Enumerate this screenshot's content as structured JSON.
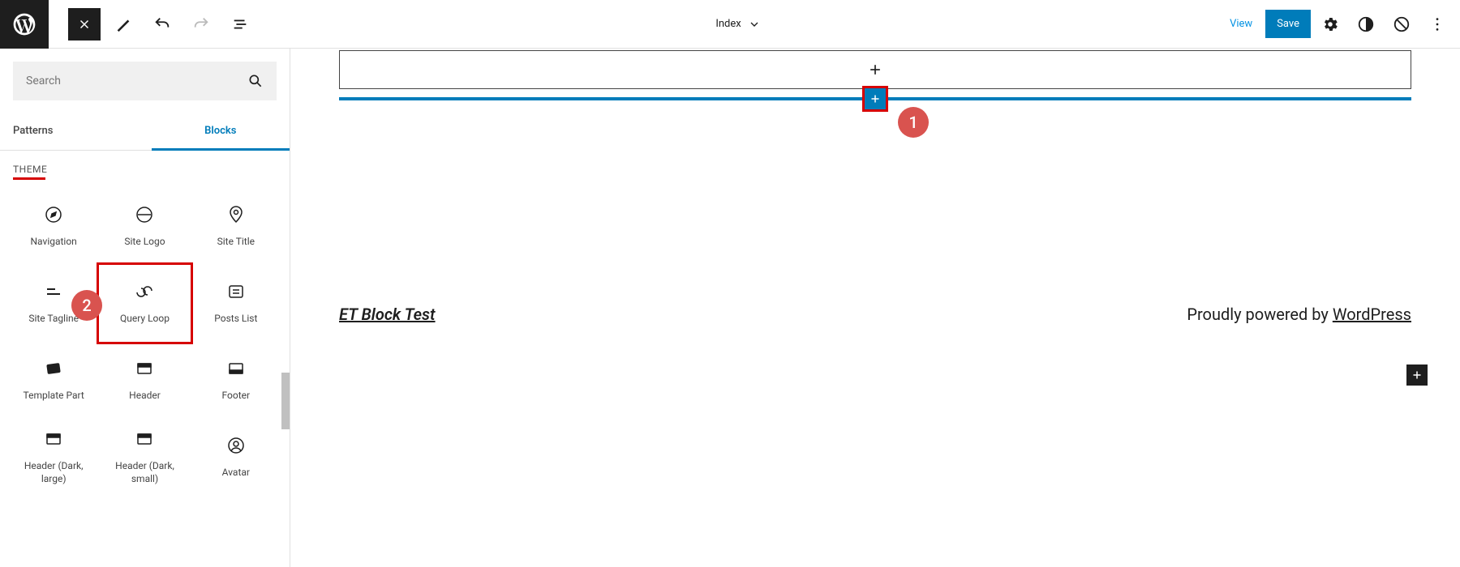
{
  "topbar": {
    "document_title": "Index",
    "view_label": "View",
    "save_label": "Save"
  },
  "panel": {
    "search_placeholder": "Search",
    "tabs": {
      "patterns": "Patterns",
      "blocks": "Blocks"
    },
    "section": "THEME",
    "blocks": [
      {
        "label": "Navigation",
        "icon": "compass"
      },
      {
        "label": "Site Logo",
        "icon": "site-logo"
      },
      {
        "label": "Site Title",
        "icon": "pin"
      },
      {
        "label": "Site Tagline",
        "icon": "tagline"
      },
      {
        "label": "Query Loop",
        "icon": "loop"
      },
      {
        "label": "Posts List",
        "icon": "list"
      },
      {
        "label": "Template Part",
        "icon": "template"
      },
      {
        "label": "Header",
        "icon": "header"
      },
      {
        "label": "Footer",
        "icon": "footer"
      },
      {
        "label": "Header (Dark, large)",
        "icon": "header"
      },
      {
        "label": "Header (Dark, small)",
        "icon": "header"
      },
      {
        "label": "Avatar",
        "icon": "avatar"
      }
    ]
  },
  "canvas": {
    "footer_site": "ET Block Test",
    "footer_text": "Proudly powered by ",
    "footer_link": "WordPress"
  },
  "annotations": {
    "badge1": "1",
    "badge2": "2",
    "highlighted_block_index": 4,
    "insert_button_highlighted": true
  }
}
